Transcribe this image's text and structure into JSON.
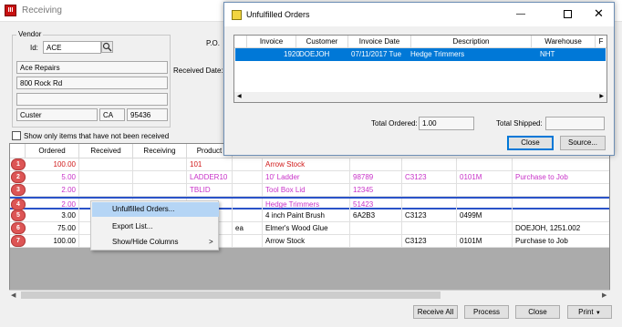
{
  "window": {
    "title": "Receiving",
    "icon": "receiving-app-icon"
  },
  "vendor": {
    "group_label": "Vendor",
    "id_label": "Id:",
    "id_value": "ACE",
    "name": "Ace Repairs",
    "address1": "800 Rock Rd",
    "address2": "",
    "city": "Custer",
    "state": "CA",
    "zip": "95436"
  },
  "header_labels": {
    "po": "P.O.",
    "received_date": "Received Date:"
  },
  "show_only_label": "Show only items that have not been received",
  "grid": {
    "columns": [
      "Ordered",
      "Received",
      "Receiving",
      "Product"
    ],
    "rows": [
      {
        "n": "1",
        "ordered": "100.00",
        "product": "101",
        "unit": "",
        "desc": "Arrow Stock",
        "part": "",
        "loc": "",
        "bin": "",
        "note": ""
      },
      {
        "n": "2",
        "ordered": "5.00",
        "product": "LADDER10",
        "unit": "",
        "desc": "10' Ladder",
        "part": "98789",
        "loc": "C3123",
        "bin": "0101M",
        "note": "Purchase to Job"
      },
      {
        "n": "3",
        "ordered": "2.00",
        "product": "TBLID",
        "unit": "",
        "desc": "Tool Box Lid",
        "part": "12345",
        "loc": "",
        "bin": "",
        "note": ""
      },
      {
        "n": "4",
        "ordered": "2.00",
        "product": "",
        "unit": "",
        "desc": "Hedge Trimmers",
        "part": "51423",
        "loc": "",
        "bin": "",
        "note": ""
      },
      {
        "n": "5",
        "ordered": "3.00",
        "product": "",
        "unit": "",
        "desc": "4 inch Paint Brush",
        "part": "6A2B3",
        "loc": "C3123",
        "bin": "0499M",
        "note": ""
      },
      {
        "n": "6",
        "ordered": "75.00",
        "product": "",
        "unit": "ea",
        "desc": "Elmer's Wood Glue",
        "part": "",
        "loc": "",
        "bin": "",
        "note": "DOEJOH, 1251.002"
      },
      {
        "n": "7",
        "ordered": "100.00",
        "product": "",
        "unit": "",
        "desc": "Arrow Stock",
        "part": "",
        "loc": "C3123",
        "bin": "0101M",
        "note": "Purchase to Job"
      }
    ]
  },
  "context_menu": {
    "items": [
      {
        "label": "Unfulfilled Orders...",
        "highlighted": true
      },
      {
        "label": "Export List...",
        "highlighted": false
      },
      {
        "label": "Show/Hide Columns",
        "highlighted": false,
        "submenu_arrow": ">"
      }
    ]
  },
  "buttons": {
    "receive_all": "Receive All",
    "process": "Process",
    "close": "Close",
    "print": "Print"
  },
  "dialog": {
    "title": "Unfulfilled Orders",
    "columns": [
      "Invoice",
      "Customer",
      "Invoice Date",
      "Description",
      "Warehouse",
      "F"
    ],
    "row": {
      "invoice": "1920",
      "customer": "DOEJOH",
      "date": "07/11/2017 Tue",
      "description": "Hedge Trimmers",
      "warehouse": "NHT"
    },
    "total_ordered_label": "Total Ordered:",
    "total_ordered_value": "1.00",
    "total_shipped_label": "Total Shipped:",
    "total_shipped_value": "",
    "close_label": "Close",
    "source_label": "Source..."
  },
  "colors": {
    "accent": "#0078d7",
    "pink": "#c832c8",
    "red": "#d01818",
    "badge": "#dd5555",
    "row_highlight": "#2a53c8"
  }
}
